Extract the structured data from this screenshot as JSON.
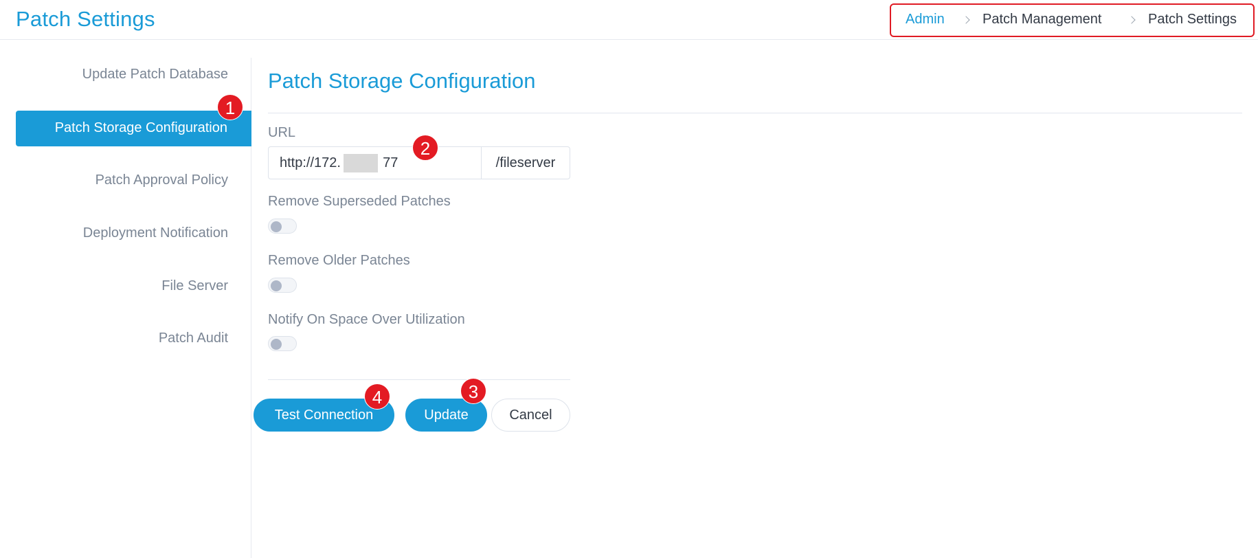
{
  "header": {
    "title": "Patch Settings",
    "breadcrumb": [
      "Admin",
      "Patch Management",
      "Patch Settings"
    ]
  },
  "sidebar": {
    "items": [
      {
        "label": "Update Patch Database"
      },
      {
        "label": "Patch Storage Configuration",
        "active": true
      },
      {
        "label": "Patch Approval Policy"
      },
      {
        "label": "Deployment Notification"
      },
      {
        "label": "File Server"
      },
      {
        "label": "Patch Audit"
      }
    ]
  },
  "main": {
    "title": "Patch Storage Configuration",
    "url": {
      "label": "URL",
      "value": "http://172.           77",
      "suffix": "/fileserver"
    },
    "toggles": [
      {
        "label": "Remove Superseded Patches",
        "on": false
      },
      {
        "label": "Remove Older Patches",
        "on": false
      },
      {
        "label": "Notify On Space Over Utilization",
        "on": false
      }
    ],
    "buttons": {
      "test_connection": "Test Connection",
      "update": "Update",
      "cancel": "Cancel"
    }
  },
  "markers": [
    "1",
    "2",
    "3",
    "4"
  ],
  "colors": {
    "accent": "#1a9bd7",
    "marker": "#e31b23",
    "highlight_border": "#e01b24"
  }
}
